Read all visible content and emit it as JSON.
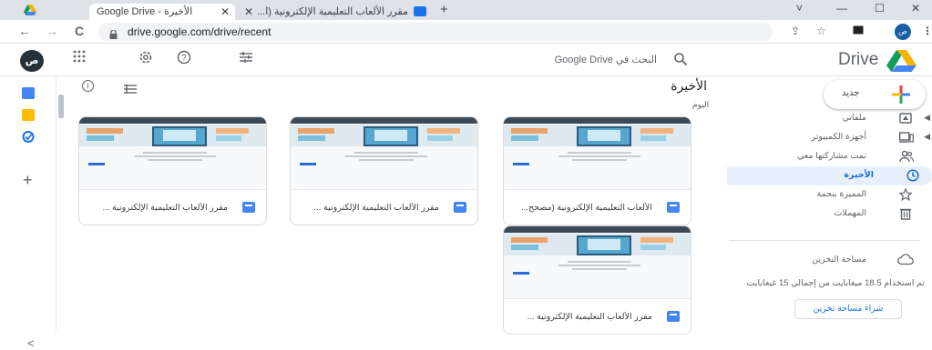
{
  "browser": {
    "tabs": [
      {
        "label": "Google Drive - الأخيرة",
        "active": true
      },
      {
        "label": "مقرر الألعاب التعليمية الإلكترونية (ا...",
        "active": false
      }
    ],
    "close_glyph": "✕",
    "new_tab_glyph": "+",
    "url": "drive.google.com/drive/recent",
    "window_controls": [
      "˅",
      "—",
      "☐",
      "✕"
    ],
    "back_glyph": "←",
    "forward_glyph": "→",
    "reload_glyph": "C",
    "share_glyph": "⇪",
    "star_glyph": "☆",
    "menu_glyph": "⋮"
  },
  "header": {
    "avatar_initials": "ص",
    "search_placeholder": "البحث في Google Drive",
    "brand": "Drive",
    "icons": [
      "apps-grid-icon",
      "settings-icon",
      "help-icon",
      "filter-options-icon"
    ]
  },
  "toolbar": {
    "title": "الأخيرة",
    "section_label": "اليوم"
  },
  "files": [
    {
      "title": "مقرر الألعاب التعليمية الإلكترونية ..."
    },
    {
      "title": "مقرر الألعاب التعليمية الإلكترونية ..."
    },
    {
      "title": "الألعاب التعليمية الإلكترونية (مصحح..."
    },
    {
      "title": "مقرر الألعاب التعليمية الإلكترونية ..."
    }
  ],
  "sidebar": {
    "new_label": "جديد",
    "nav": [
      {
        "label": "ملفاتي",
        "icon": "my-drive-icon",
        "caret": true,
        "active": false
      },
      {
        "label": "أجهزة الكمبيوتر",
        "icon": "computers-icon",
        "caret": true,
        "active": false
      },
      {
        "label": "تمت مشاركتها معي",
        "icon": "shared-icon",
        "caret": false,
        "active": false
      },
      {
        "label": "الأخيرة",
        "icon": "recent-icon",
        "caret": false,
        "active": true
      },
      {
        "label": "المميزة بنجمة",
        "icon": "star-icon",
        "caret": false,
        "active": false
      },
      {
        "label": "المهملات",
        "icon": "trash-icon",
        "caret": false,
        "active": false
      }
    ],
    "storage_label": "مساحة التخزين",
    "storage_usage": "تم استخدام 18.5 ميغابايت من إجمالي 15 غيغابايت",
    "buy_storage": "شراء مساحة تخزين"
  },
  "colors": {
    "accent": "#1a73e8",
    "active_bg": "#e8f0fe",
    "drive_green": "#0f9d58",
    "drive_yellow": "#f4b400",
    "drive_blue": "#4285f4"
  }
}
